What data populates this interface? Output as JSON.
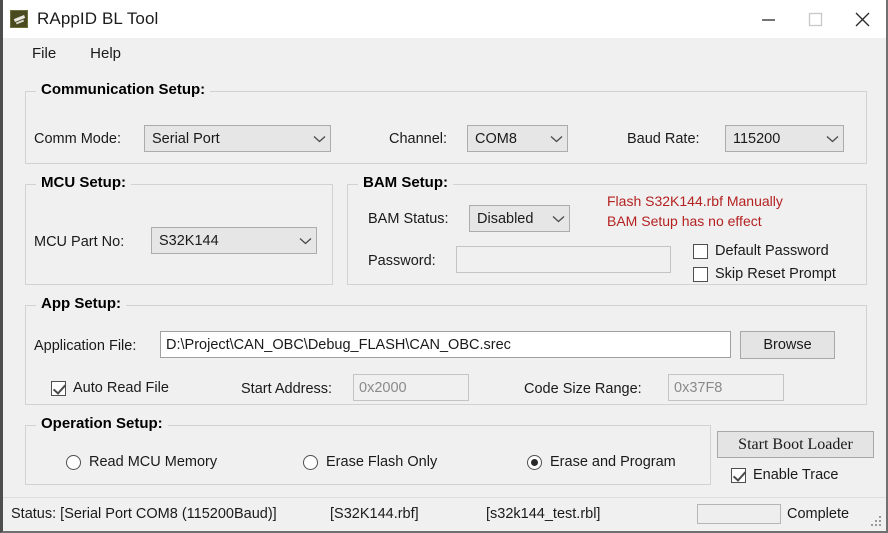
{
  "window": {
    "title": "RAppID BL Tool",
    "icon": "app-icon",
    "controls": {
      "minimize": "minimize-icon",
      "maximize": "maximize-icon",
      "close": "close-icon"
    }
  },
  "menu": {
    "items": [
      "File",
      "Help"
    ]
  },
  "communication_setup": {
    "title": "Communication Setup:",
    "comm_mode_label": "Comm Mode:",
    "comm_mode_value": "Serial Port",
    "channel_label": "Channel:",
    "channel_value": "COM8",
    "baud_rate_label": "Baud Rate:",
    "baud_rate_value": "115200"
  },
  "mcu_setup": {
    "title": "MCU Setup:",
    "part_no_label": "MCU Part No:",
    "part_no_value": "S32K144"
  },
  "bam_setup": {
    "title": "BAM Setup:",
    "status_label": "BAM Status:",
    "status_value": "Disabled",
    "password_label": "Password:",
    "password_value": "",
    "warning_line1": "Flash S32K144.rbf Manually",
    "warning_line2": "BAM Setup has no effect",
    "warning_color": "#b42121",
    "default_password_label": "Default Password",
    "default_password_checked": false,
    "skip_reset_label": "Skip Reset Prompt",
    "skip_reset_checked": false
  },
  "app_setup": {
    "title": "App Setup:",
    "application_file_label": "Application File:",
    "application_file_value": "D:\\Project\\CAN_OBC\\Debug_FLASH\\CAN_OBC.srec",
    "browse_label": "Browse",
    "auto_read_label": "Auto Read File",
    "auto_read_checked": true,
    "start_address_label": "Start Address:",
    "start_address_value": "0x2000",
    "code_size_label": "Code Size Range:",
    "code_size_value": "0x37F8"
  },
  "operation_setup": {
    "title": "Operation Setup:",
    "options": [
      {
        "label": "Read MCU Memory",
        "selected": false
      },
      {
        "label": "Erase Flash Only",
        "selected": false
      },
      {
        "label": "Erase and Program",
        "selected": true
      }
    ],
    "start_button_label": "Start Boot Loader",
    "enable_trace_label": "Enable Trace",
    "enable_trace_checked": true
  },
  "status_bar": {
    "status_text": "Status: [Serial Port COM8 (115200Baud)]",
    "rbf_file": "[S32K144.rbf]",
    "rbl_file": "[s32k144_test.rbl]",
    "progress_value": "",
    "complete_text": "Complete"
  }
}
